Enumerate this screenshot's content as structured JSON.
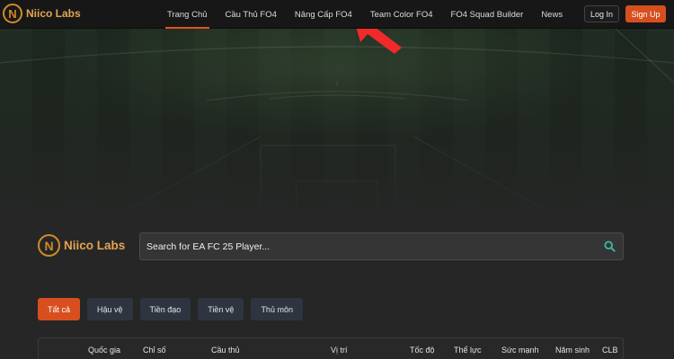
{
  "brand": {
    "logo_letter": "N",
    "name": "Niico Labs"
  },
  "nav": {
    "items": [
      {
        "label": "Trang Chủ",
        "active": true
      },
      {
        "label": "Cầu Thủ FO4",
        "active": false
      },
      {
        "label": "Nâng Cấp FO4",
        "active": false
      },
      {
        "label": "Team Color FO4",
        "active": false
      },
      {
        "label": "FO4 Squad Builder",
        "active": false
      },
      {
        "label": "News",
        "active": false
      }
    ],
    "login_label": "Log In",
    "signup_label": "Sign Up"
  },
  "search": {
    "logo_letter": "N",
    "logo_name": "Niico Labs",
    "placeholder": "Search for EA FC 25 Player...",
    "icon": "search-icon"
  },
  "filters": [
    {
      "label": "Tất cả",
      "active": true
    },
    {
      "label": "Hậu vệ",
      "active": false
    },
    {
      "label": "Tiền đạo",
      "active": false
    },
    {
      "label": "Tiền vệ",
      "active": false
    },
    {
      "label": "Thủ môn",
      "active": false
    }
  ],
  "table": {
    "columns": [
      "Quốc gia",
      "Chỉ số",
      "Cầu thủ",
      "Vị trí",
      "Tốc độ",
      "Thể lực",
      "Sức mạnh",
      "Năm sinh",
      "CLB"
    ]
  },
  "colors": {
    "accent": "#d84f1f",
    "brand": "#e2a453",
    "search_icon": "#3fb7a5",
    "annotation_arrow": "#f0292b"
  }
}
